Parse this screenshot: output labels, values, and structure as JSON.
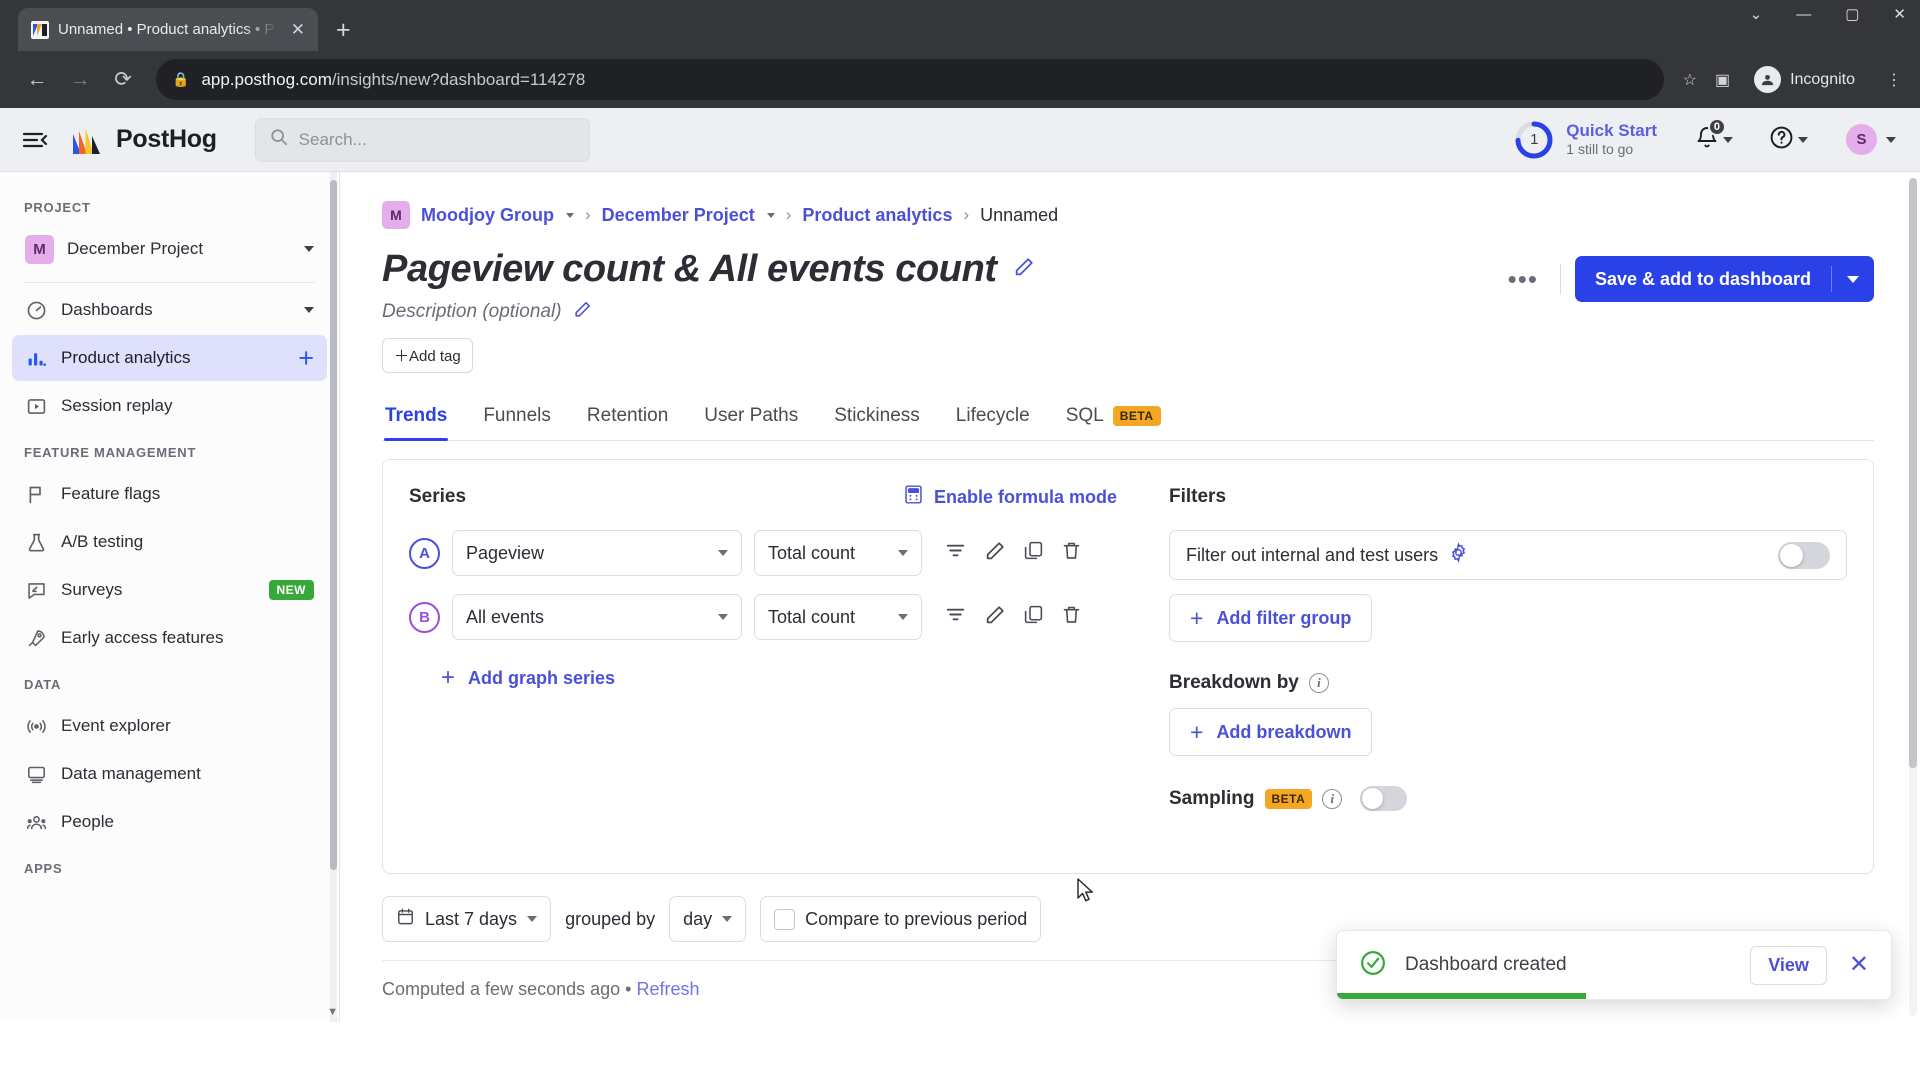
{
  "browser": {
    "tab_title": "Unnamed • Product analytics • P",
    "tab_close": "✕",
    "new_tab": "+",
    "url_host": "app.posthog.com",
    "url_path": "/insights/new?dashboard=114278",
    "profile_label": "Incognito",
    "minimize": "—",
    "maximize": "▢",
    "close": "✕",
    "collapse": "⌄"
  },
  "topbar": {
    "logo_text": "PostHog",
    "search_placeholder": "Search...",
    "quick_start_title": "Quick Start",
    "quick_start_sub": "1 still to go",
    "quick_start_count": "1",
    "notifications_count": "0",
    "help_glyph": "?",
    "avatar_initial": "S"
  },
  "sidebar": {
    "sections": [
      {
        "label": "PROJECT",
        "items": [
          {
            "label": "December Project",
            "icon": "project-badge-icon",
            "badge_initial": "M",
            "trailing": "caret"
          }
        ]
      },
      {
        "label": "",
        "items": [
          {
            "label": "Dashboards",
            "icon": "gauge-icon",
            "trailing": "caret"
          },
          {
            "label": "Product analytics",
            "icon": "bar-chart-icon",
            "trailing": "plus",
            "active": true
          },
          {
            "label": "Session replay",
            "icon": "play-square-icon"
          }
        ]
      },
      {
        "label": "FEATURE MANAGEMENT",
        "items": [
          {
            "label": "Feature flags",
            "icon": "flag-icon"
          },
          {
            "label": "A/B testing",
            "icon": "flask-icon"
          },
          {
            "label": "Surveys",
            "icon": "survey-icon",
            "badge": "NEW"
          },
          {
            "label": "Early access features",
            "icon": "rocket-icon"
          }
        ]
      },
      {
        "label": "DATA",
        "items": [
          {
            "label": "Event explorer",
            "icon": "broadcast-icon"
          },
          {
            "label": "Data management",
            "icon": "monitor-icon"
          },
          {
            "label": "People",
            "icon": "people-icon"
          }
        ]
      },
      {
        "label": "APPS",
        "items": []
      }
    ]
  },
  "breadcrumb": {
    "org_initial": "M",
    "items": [
      {
        "label": "Moodjoy Group",
        "link": true,
        "caret": true
      },
      {
        "label": "December Project",
        "link": true,
        "caret": true
      },
      {
        "label": "Product analytics",
        "link": true,
        "caret": false
      },
      {
        "label": "Unnamed",
        "link": false,
        "caret": false
      }
    ],
    "separator": "›"
  },
  "header": {
    "title": "Pageview count & All events count",
    "description_placeholder": "Description (optional)",
    "add_tag_label": "＋Add tag",
    "more_label": "•••",
    "save_label": "Save & add to dashboard"
  },
  "tabs": [
    {
      "label": "Trends",
      "active": true
    },
    {
      "label": "Funnels",
      "active": false
    },
    {
      "label": "Retention",
      "active": false
    },
    {
      "label": "User Paths",
      "active": false
    },
    {
      "label": "Stickiness",
      "active": false
    },
    {
      "label": "Lifecycle",
      "active": false
    },
    {
      "label": "SQL",
      "active": false,
      "badge": "BETA"
    }
  ],
  "series_panel": {
    "title": "Series",
    "formula_link": "Enable formula mode",
    "rows": [
      {
        "badge": "A",
        "event": "Pageview",
        "math": "Total count"
      },
      {
        "badge": "B",
        "event": "All events",
        "math": "Total count"
      }
    ],
    "add_series_label": "Add graph series",
    "add_series_plus": "+"
  },
  "filters_panel": {
    "title": "Filters",
    "internal_users_label": "Filter out internal and test users",
    "internal_users_on": false,
    "add_filter_group_label": "Add filter group",
    "breakdown_title": "Breakdown by",
    "add_breakdown_label": "Add breakdown",
    "sampling_title": "Sampling",
    "sampling_badge": "BETA",
    "sampling_on": false,
    "plus": "+"
  },
  "date_bar": {
    "date_range": "Last 7 days",
    "grouped_by_label": "grouped by",
    "interval": "day",
    "compare_label": "Compare to previous period",
    "compare_checked": false
  },
  "computed": {
    "text": "Computed a few seconds ago",
    "separator": "•",
    "refresh_label": "Refresh"
  },
  "toast": {
    "message": "Dashboard created",
    "view_label": "View",
    "close_glyph": "✕",
    "progress_percent": 45,
    "accent_color": "#36a93a"
  },
  "colors": {
    "brand_blue": "#2b41e8",
    "link_purple": "#4b50d8",
    "series_a": "#4b50d8",
    "series_b": "#9b4fd8",
    "beta_amber": "#f5a623",
    "new_green": "#36a93a",
    "avatar_pink": "#e4aeeb"
  }
}
